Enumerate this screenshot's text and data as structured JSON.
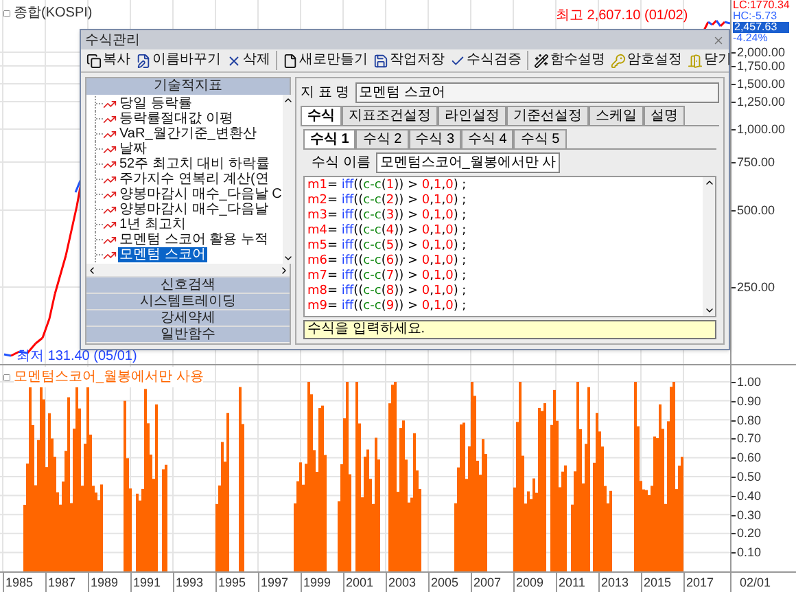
{
  "main_chart": {
    "title": "종합(KOSPI)",
    "high_label": "최고 2,607.10 (01/02)",
    "low_label": "최저 131.40 (05/01)",
    "price_labels": [
      {
        "text": "LC:1770.34",
        "kind": "plain",
        "color": "#ff0000"
      },
      {
        "text": "HC:-5.73",
        "kind": "plain",
        "color": "#3366ff"
      },
      {
        "text": "2,457.63",
        "kind": "highlight",
        "color": "#1a5fd0"
      },
      {
        "text": "-4.24%",
        "kind": "plain",
        "color": "#3366ff"
      }
    ],
    "yticks": [
      "2,000.00",
      "1,750.00",
      "1,500.00",
      "1,250.00",
      "1,000.00",
      "750.00",
      "500.00",
      "250.00"
    ]
  },
  "indicator_chart": {
    "title": "모멘텀스코어_월봉에서만 사용",
    "yticks": [
      "1.00",
      "0.90",
      "0.80",
      "0.70",
      "0.60",
      "0.50",
      "0.40",
      "0.30",
      "0.20",
      "0.10"
    ]
  },
  "x_axis": {
    "labels": [
      "1985",
      "1987",
      "1989",
      "1991",
      "1993",
      "1995",
      "1997",
      "1999",
      "2001",
      "2003",
      "2005",
      "2007",
      "2009",
      "2011",
      "2013",
      "2015",
      "2017"
    ],
    "cursor_date": "02/01"
  },
  "dialog": {
    "title": "수식관리",
    "toolbar_groups": [
      [
        "복사",
        "이름바꾸기",
        "삭제"
      ],
      [
        "새로만들기",
        "작업저장",
        "수식검증"
      ],
      [
        "함수설명",
        "암호설정",
        "닫기"
      ]
    ],
    "sidebar": {
      "header": "기술적지표",
      "items": [
        {
          "label": "당일 등락률",
          "selected": false
        },
        {
          "label": "등락률절대값 이평",
          "selected": false
        },
        {
          "label": "VaR_월간기준_변환산",
          "selected": false
        },
        {
          "label": "날짜",
          "selected": false
        },
        {
          "label": "52주 최고치 대비 하락률",
          "selected": false
        },
        {
          "label": "주가지수 연복리 계산(연",
          "selected": false
        },
        {
          "label": "양봉마감시 매수_다음날 C",
          "selected": false
        },
        {
          "label": "양봉마감시 매수_다음날",
          "selected": false
        },
        {
          "label": "1년 최고치",
          "selected": false
        },
        {
          "label": "모멘텀 스코어 활용 누적",
          "selected": false
        },
        {
          "label": "모멘텀 스코어",
          "selected": true
        }
      ],
      "categories": [
        "신호검색",
        "시스템트레이딩",
        "강세약세",
        "일반함수"
      ]
    },
    "name_label": "지 표 명",
    "name_value": "모멘텀 스코어",
    "tabs": [
      {
        "label": "수식",
        "selected": true
      },
      {
        "label": "지표조건설정",
        "selected": false
      },
      {
        "label": "라인설정",
        "selected": false
      },
      {
        "label": "기준선설정",
        "selected": false
      },
      {
        "label": "스케일",
        "selected": false
      },
      {
        "label": "설명",
        "selected": false
      }
    ],
    "formula_tabs": [
      {
        "label": "수식 1",
        "selected": true
      },
      {
        "label": "수식 2",
        "selected": false
      },
      {
        "label": "수식 3",
        "selected": false
      },
      {
        "label": "수식 4",
        "selected": false
      },
      {
        "label": "수식 5",
        "selected": false
      }
    ],
    "formula_name_label": "수식 이름",
    "formula_name_value": "모멘텀스코어_월봉에서만 사",
    "code_lines": [
      "m1= iff((c-c(1)) > 0,1,0) ;",
      "m2= iff((c-c(2)) > 0,1,0) ;",
      "m3= iff((c-c(3)) > 0,1,0) ;",
      "m4= iff((c-c(4)) > 0,1,0) ;",
      "m5= iff((c-c(5)) > 0,1,0) ;",
      "m6= iff((c-c(6)) > 0,1,0) ;",
      "m7= iff((c-c(7)) > 0,1,0) ;",
      "m8= iff((c-c(8)) > 0,1,0) ;",
      "m9= iff((c-c(9)) > 0,1,0) ;"
    ],
    "hint": "수식을 입력하세요."
  }
}
